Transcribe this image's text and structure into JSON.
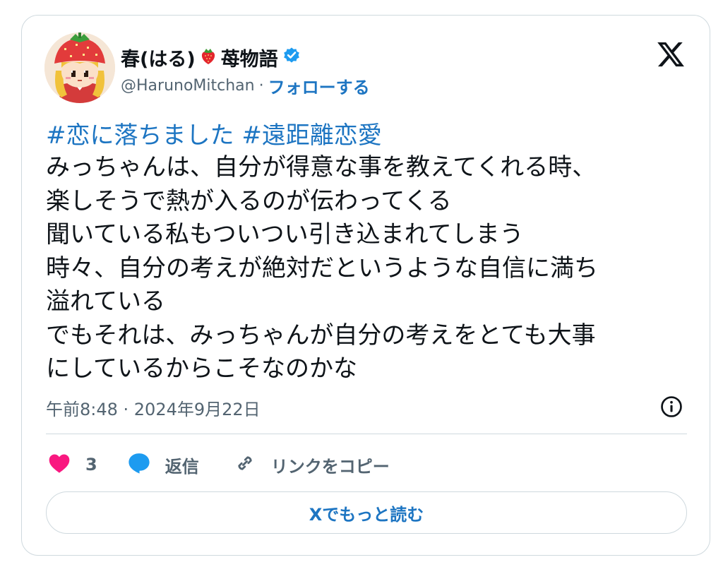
{
  "author": {
    "name_prefix": "春(はる)",
    "name_suffix": "苺物語",
    "emoji_icon": "strawberry-icon",
    "verified_icon": "verified-badge-icon",
    "handle": "@HarunoMitchan",
    "separator": "·",
    "follow_label": "フォローする"
  },
  "brand": {
    "logo_icon": "x-logo-icon"
  },
  "tweet": {
    "hashtags": [
      "#恋に落ちました",
      "#遠距離恋愛"
    ],
    "lines": [
      "みっちゃんは、自分が得意な事を教えてくれる時、",
      "楽しそうで熱が入るのが伝わってくる",
      "聞いている私もついつい引き込まれてしまう",
      "時々、自分の考えが絶対だというような自信に満ち",
      "溢れている",
      "でもそれは、みっちゃんが自分の考えをとても大事",
      "にしているからこそなのかな"
    ],
    "timestamp": "午前8:48 · 2024年9月22日"
  },
  "actions": {
    "like_count": "3",
    "reply_label": "返信",
    "copy_link_label": "リンクをコピー",
    "read_more_label": "Xでもっと読む"
  },
  "colors": {
    "link": "#1d75c2",
    "like": "#f91880",
    "reply": "#1d9bf0",
    "verified": "#1d9bf0",
    "muted_text": "#536471",
    "border": "#cfd9de"
  }
}
